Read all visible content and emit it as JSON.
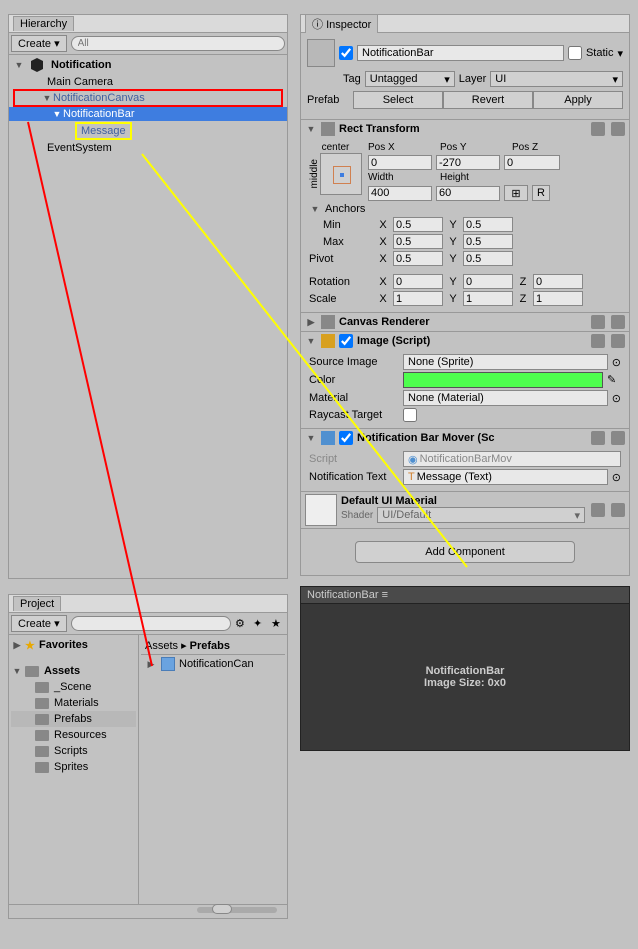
{
  "hierarchy": {
    "title": "Hierarchy",
    "create": "Create",
    "search_placeholder": "All",
    "scene": "Notification",
    "items": [
      "Main Camera",
      "NotificationCanvas",
      "NotificationBar",
      "Message",
      "EventSystem"
    ]
  },
  "project": {
    "title": "Project",
    "create": "Create",
    "favorites": "Favorites",
    "assets": "Assets",
    "folders": [
      "_Scene",
      "Materials",
      "Prefabs",
      "Resources",
      "Scripts",
      "Sprites"
    ],
    "breadcrumb_assets": "Assets",
    "breadcrumb_prefabs": "Prefabs",
    "prefab_item": "NotificationCan"
  },
  "inspector": {
    "title": "Inspector",
    "go_name": "NotificationBar",
    "static_label": "Static",
    "tag_label": "Tag",
    "tag_value": "Untagged",
    "layer_label": "Layer",
    "layer_value": "UI",
    "prefab_label": "Prefab",
    "select": "Select",
    "revert": "Revert",
    "apply": "Apply"
  },
  "rect": {
    "title": "Rect Transform",
    "anchor_preset": "center",
    "middle": "middle",
    "posx_label": "Pos X",
    "posy_label": "Pos Y",
    "posz_label": "Pos Z",
    "posx": "0",
    "posy": "-270",
    "posz": "0",
    "width_label": "Width",
    "height_label": "Height",
    "width": "400",
    "height": "60",
    "anchors": "Anchors",
    "min_label": "Min",
    "max_label": "Max",
    "min_x": "0.5",
    "min_y": "0.5",
    "max_x": "0.5",
    "max_y": "0.5",
    "pivot_label": "Pivot",
    "pivot_x": "0.5",
    "pivot_y": "0.5",
    "rotation_label": "Rotation",
    "rot_x": "0",
    "rot_y": "0",
    "rot_z": "0",
    "scale_label": "Scale",
    "scale_x": "1",
    "scale_y": "1",
    "scale_z": "1",
    "blueprint": "R"
  },
  "canvas_renderer": {
    "title": "Canvas Renderer"
  },
  "image": {
    "title": "Image (Script)",
    "source_label": "Source Image",
    "source_value": "None (Sprite)",
    "color_label": "Color",
    "material_label": "Material",
    "material_value": "None (Material)",
    "raycast_label": "Raycast Target"
  },
  "mover": {
    "title": "Notification Bar Mover (Sc",
    "script_label": "Script",
    "script_value": "NotificationBarMov",
    "notif_text_label": "Notification Text",
    "notif_text_value": "Message (Text)"
  },
  "material": {
    "name": "Default UI Material",
    "shader_label": "Shader",
    "shader_value": "UI/Default"
  },
  "add_component": "Add Component",
  "preview": {
    "title": "NotificationBar",
    "name": "NotificationBar",
    "size": "Image Size: 0x0"
  }
}
